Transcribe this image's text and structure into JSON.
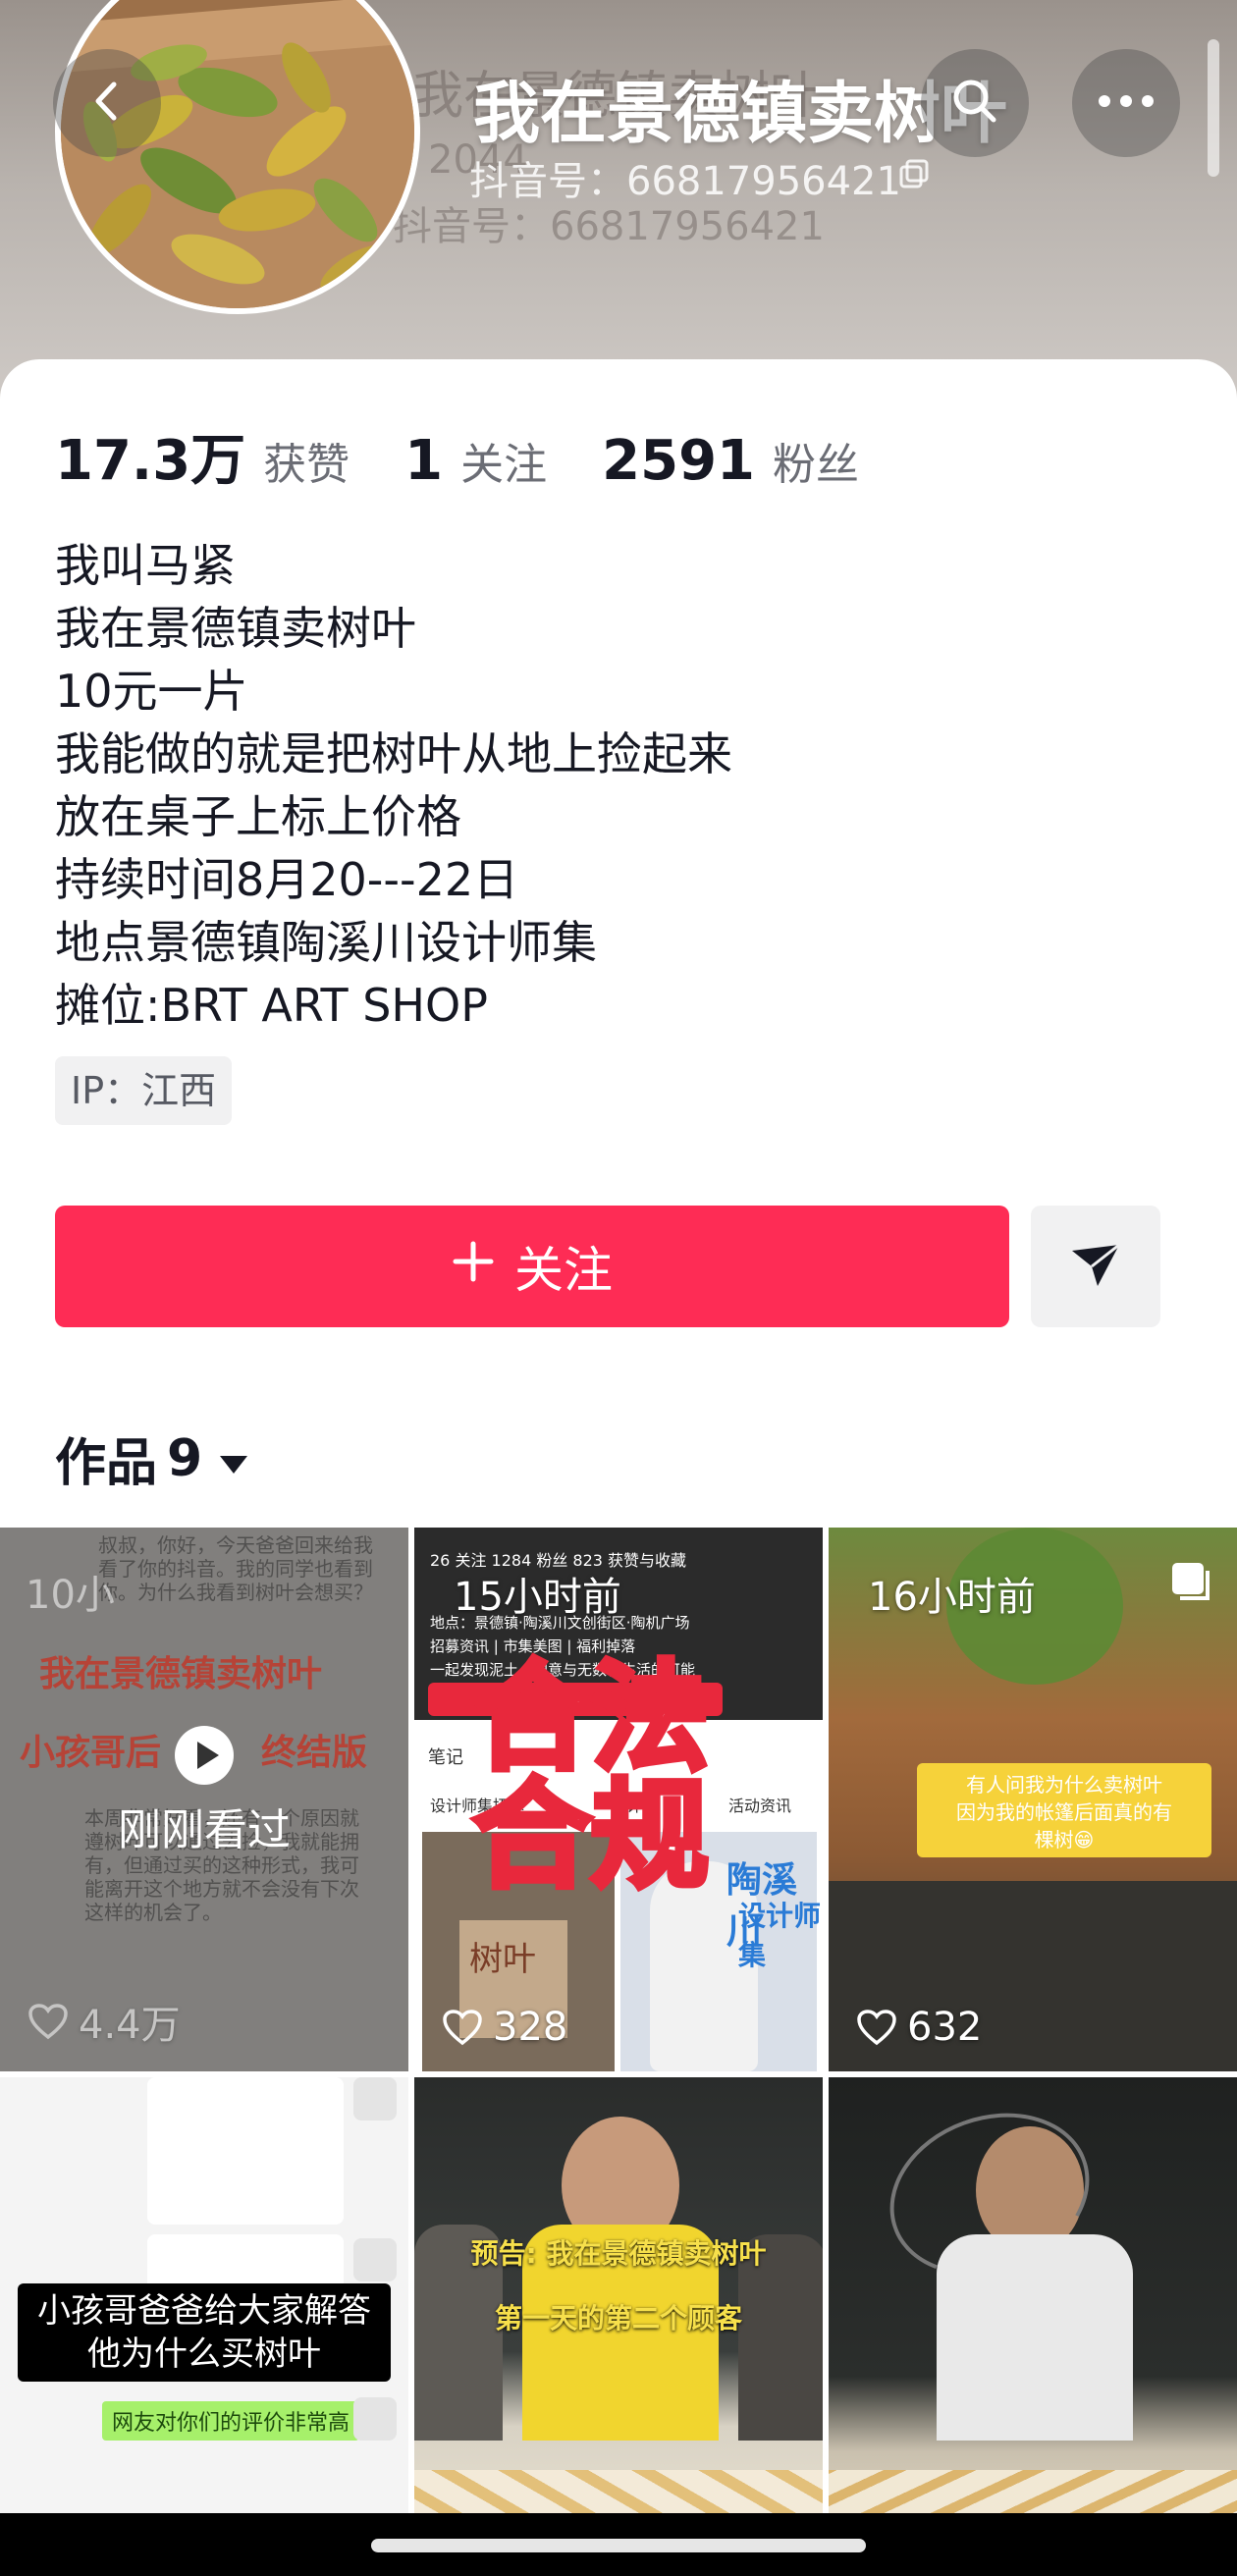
{
  "header": {
    "title": "我在景德镇卖树叶",
    "subtitle": "抖音号：66817956421",
    "ghost_name": "我在景德镇卖树叶",
    "ghost_count": "2044",
    "ghost_id": "抖音号：66817956421"
  },
  "icons": {
    "back": "chevron-left-icon",
    "search": "search-icon",
    "more": "more-dots-icon",
    "copy": "copy-icon",
    "share": "send-icon",
    "heart": "heart-icon",
    "play": "play-icon"
  },
  "stats": {
    "likes_value": "17.3万",
    "likes_label": "获赞",
    "following_value": "1",
    "following_label": "关注",
    "followers_value": "2591",
    "followers_label": "粉丝"
  },
  "bio": [
    "我叫马紧",
    "我在景德镇卖树叶",
    "10元一片",
    "我能做的就是把树叶从地上捡起来",
    "放在桌子上标上价格",
    "持续时间8月20---22日",
    "地点景德镇陶溪川设计师集",
    "摊位:BRT ART SHOP"
  ],
  "ip_tag": "IP：江西",
  "follow_button": "关注",
  "works": {
    "label": "作品",
    "count": "9"
  },
  "colors": {
    "accent": "#fe2c55",
    "text": "#161823",
    "muted": "#6b6d75"
  },
  "tiles": [
    {
      "overlay": "刚刚看过",
      "likes": "4.4万",
      "time": "10小",
      "title1": "我在景德镇卖树叶",
      "title2": "小孩哥后",
      "title3": "终结版",
      "text_top1": "叔叔，你好，今天爸爸回来给我",
      "text_top2": "看了你的抖音。我的同学也看到",
      "text_top3": "你。为什么我看到树叶会想买？",
      "text_bottom1": "本周非常好看，还有一个原因就",
      "text_bottom2": "遵树叶可以通过去捡，我就能拥",
      "text_bottom3": "有，但通过买的这种形式，我可",
      "text_bottom4": "能离开这个地方就不会没有下次",
      "text_bottom5": "这样的机会了。"
    },
    {
      "time": "15小时前",
      "likes": "328",
      "big_text1": "合法",
      "big_text2": "合规",
      "stat_line": "26 关注  1284 粉丝  823 获赞与收藏",
      "loc_line": "地点：景德镇·陶溪川文创街区·陶机广场",
      "tags_line": "招募资讯 | 市集美图 | 福利掉落",
      "slogan_line": "一起发现泥土、创意与无数种生活的可能",
      "note_label": "笔记",
      "tab1": "设计师集招募",
      "tab2": "设计",
      "tab3": "活动资讯",
      "sign_text1": "陶溪川",
      "sign_text2": "设计师集",
      "card_text": "树叶"
    },
    {
      "time": "16小时前",
      "likes": "632",
      "caption1": "有人问我为什么卖树叶",
      "caption2": "因为我的帐篷后面真的有",
      "caption3": "棵树😁"
    },
    {
      "caption1": "小孩哥爸爸给大家解答",
      "caption2": "他为什么买树叶",
      "comment": "网友对你们的评价非常高"
    },
    {
      "caption1": "预告: 我在景德镇卖树叶",
      "caption2": "第一天的第二个顾客"
    },
    {}
  ]
}
